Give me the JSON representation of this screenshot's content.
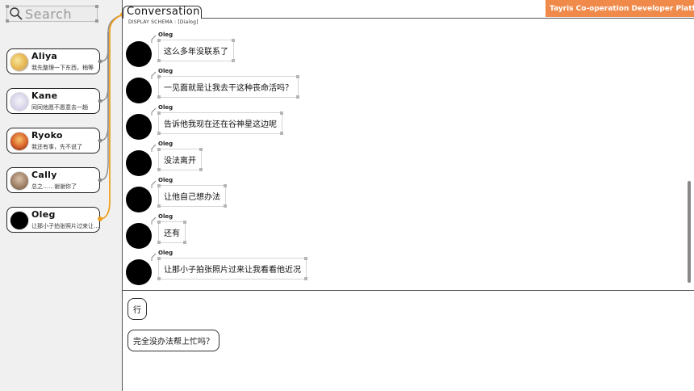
{
  "search": {
    "placeholder": "Search"
  },
  "brand": {
    "name": "Tayris Co-operation Developer Platform",
    "color": "#f08a4b"
  },
  "tab": {
    "title": "Conversation"
  },
  "schema_label": "DISPLAY SCHEMA : [Dialog]",
  "accent_color": "#f0a020",
  "contacts": [
    {
      "name": "Aliya",
      "preview": "我先整理一下东西，稍等"
    },
    {
      "name": "Kane",
      "preview": "同同他愿不愿意去一趟"
    },
    {
      "name": "Ryoko",
      "preview": "我还有事，先不说了"
    },
    {
      "name": "Cally",
      "preview": "总之……谢谢你了"
    },
    {
      "name": "Oleg",
      "preview": "让那小子拍张照片过来让我看看他近况"
    }
  ],
  "messages": [
    {
      "sender": "Oleg",
      "text": "这么多年没联系了"
    },
    {
      "sender": "Oleg",
      "text": "一见面就是让我去干这种丧命活吗？"
    },
    {
      "sender": "Oleg",
      "text": "告诉他我现在还在谷神星这边呢"
    },
    {
      "sender": "Oleg",
      "text": "没法离开"
    },
    {
      "sender": "Oleg",
      "text": "让他自己想办法"
    },
    {
      "sender": "Oleg",
      "text": "还有"
    },
    {
      "sender": "Oleg",
      "text": "让那小子拍张照片过来让我看看他近况"
    }
  ],
  "replies": [
    {
      "text": "行"
    },
    {
      "text": "完全没办法帮上忙吗？"
    }
  ]
}
